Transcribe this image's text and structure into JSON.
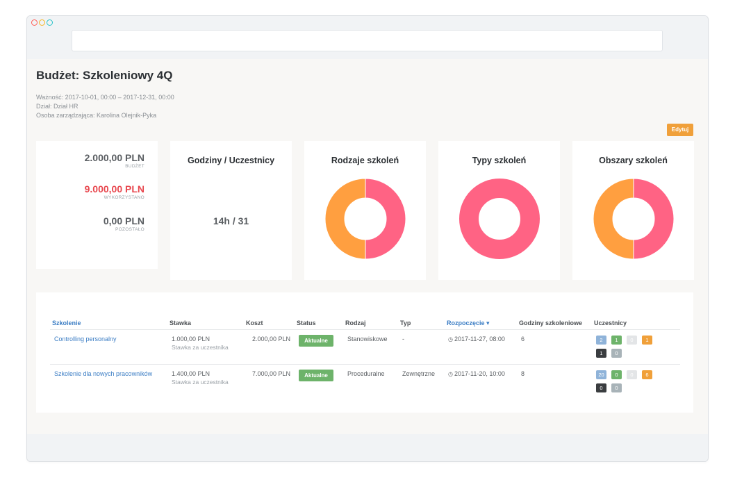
{
  "colors": {
    "accent_orange": "#f0a03a",
    "donut_orange": "#ff9f40",
    "donut_pink": "#ff6384",
    "red": "#e8484f",
    "link_blue": "#3b7dc4",
    "status_green": "#6db36a"
  },
  "page": {
    "title": "Budżet: Szkoleniowy 4Q",
    "meta": [
      "Ważność: 2017-10-01, 00:00 – 2017-12-31, 00:00",
      "Dział: Dział HR",
      "Osoba zarządzająca: Karolina Olejnik-Pyka"
    ],
    "edit_label": "Edytuj"
  },
  "budget": {
    "budget_value": "2.000,00 PLN",
    "budget_label": "BUDŻET",
    "used_value": "9.000,00 PLN",
    "used_label": "WYKORZYSTANO",
    "left_value": "0,00 PLN",
    "left_label": "POZOSTAŁO"
  },
  "hours_card": {
    "title": "Godziny / Uczestnicy",
    "value": "14h / 31"
  },
  "chart_data": [
    {
      "type": "pie",
      "title": "Rodzaje szkoleń",
      "donut": true,
      "values": [
        50,
        50
      ],
      "colors": [
        "#ff6384",
        "#ff9f40"
      ]
    },
    {
      "type": "pie",
      "title": "Typy szkoleń",
      "donut": true,
      "values": [
        100
      ],
      "colors": [
        "#ff6384"
      ]
    },
    {
      "type": "pie",
      "title": "Obszary szkoleń",
      "donut": true,
      "values": [
        50,
        50
      ],
      "colors": [
        "#ff6384",
        "#ff9f40"
      ]
    }
  ],
  "table": {
    "headers": [
      "Szkolenie",
      "Stawka",
      "Koszt",
      "Status",
      "Rodzaj",
      "Typ",
      "Rozpoczęcie ▾",
      "Godziny szkoleniowe",
      "Uczestnicy"
    ],
    "rows": [
      {
        "name": "Controlling personalny",
        "rate": "1.000,00 PLN",
        "rate_sub": "Stawka za uczestnika",
        "cost": "2.000,00 PLN",
        "status": "Aktualne",
        "kind": "Stanowiskowe",
        "type": "-",
        "start": "2017-11-27, 08:00",
        "hours": "6",
        "badges": [
          {
            "text": "2",
            "color": "#8fb3d9"
          },
          {
            "text": "1",
            "color": "#6db36a"
          },
          {
            "text": "0",
            "color": "#e3e5e7"
          },
          {
            "text": "1",
            "color": "#f0a03a"
          },
          {
            "text": "1",
            "color": "#3a3d40"
          },
          {
            "text": "0",
            "color": "#a8b3b8"
          }
        ]
      },
      {
        "name": "Szkolenie dla nowych pracowników",
        "rate": "1.400,00 PLN",
        "rate_sub": "Stawka za uczestnika",
        "cost": "7.000,00 PLN",
        "status": "Aktualne",
        "kind": "Proceduralne",
        "type": "Zewnętrzne",
        "start": "2017-11-20, 10:00",
        "hours": "8",
        "badges": [
          {
            "text": "20",
            "color": "#8fb3d9"
          },
          {
            "text": "0",
            "color": "#6db36a"
          },
          {
            "text": "0",
            "color": "#e3e5e7"
          },
          {
            "text": "6",
            "color": "#f0a03a"
          },
          {
            "text": "0",
            "color": "#3a3d40"
          },
          {
            "text": "0",
            "color": "#a8b3b8"
          }
        ]
      }
    ]
  }
}
